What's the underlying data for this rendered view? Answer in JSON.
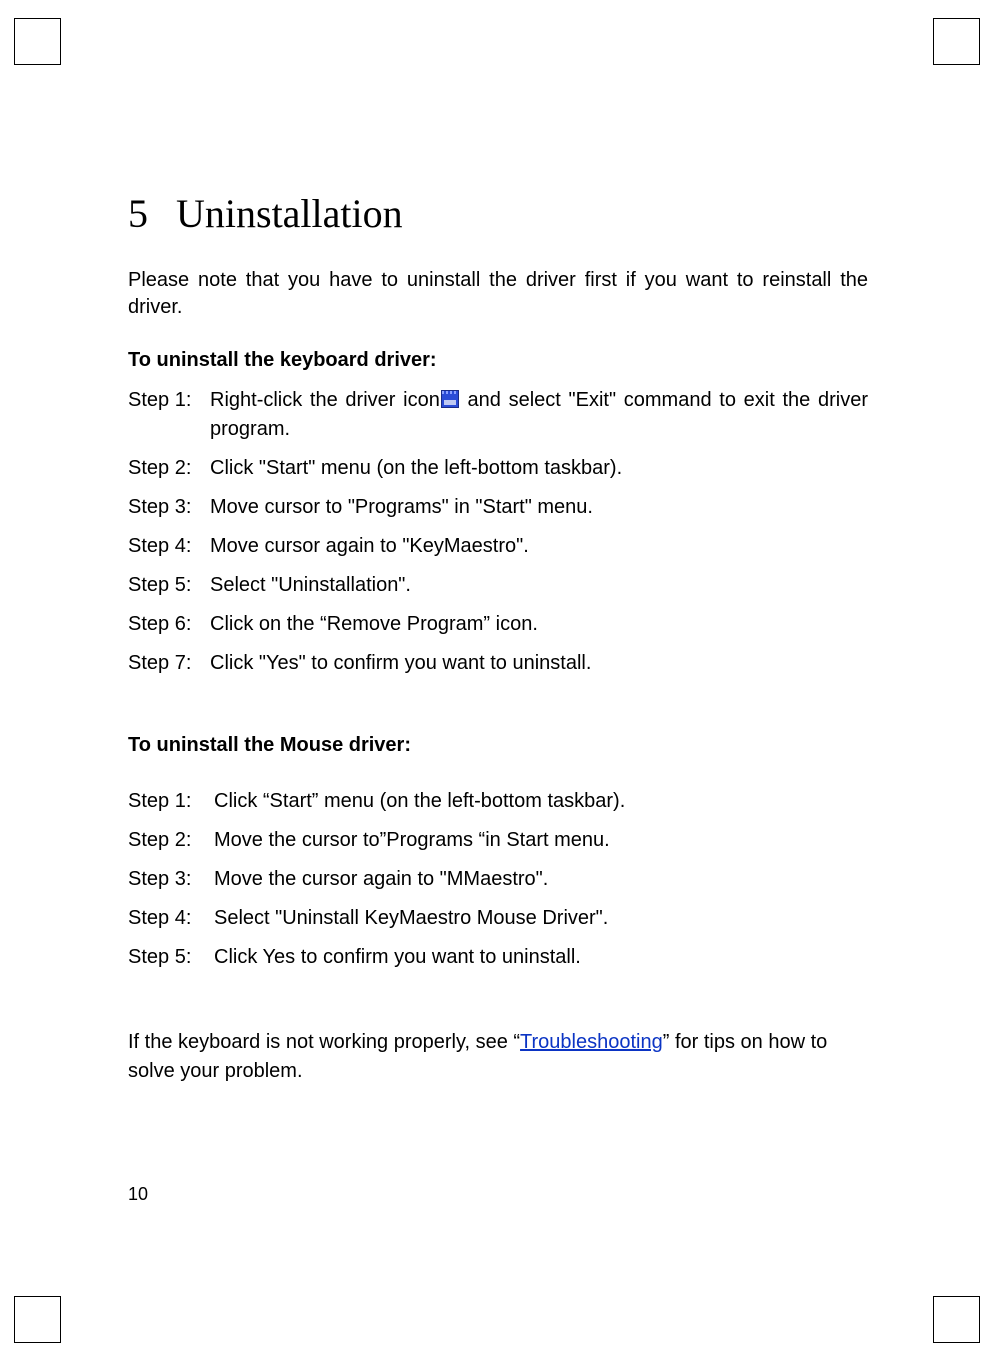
{
  "heading": {
    "number": "5",
    "title": "Uninstallation"
  },
  "intro": "Please note that you have to uninstall the driver first if you want to reinstall the driver.",
  "kb": {
    "heading": "To uninstall the keyboard driver:",
    "steps": [
      {
        "label": "Step 1:",
        "pre": "Right-click the driver icon",
        "post": " and select \"Exit\" command to exit the driver program."
      },
      {
        "label": "Step 2:",
        "text": "Click \"Start\" menu (on the left-bottom taskbar)."
      },
      {
        "label": "Step 3:",
        "text": "Move cursor to \"Programs\" in \"Start\" menu."
      },
      {
        "label": "Step 4:",
        "text": "Move cursor again to \"KeyMaestro\"."
      },
      {
        "label": "Step 5:",
        "text": "Select \"Uninstallation\"."
      },
      {
        "label": "Step 6:",
        "text": "Click on the “Remove Program” icon."
      },
      {
        "label": "Step 7:",
        "text": "Click \"Yes\" to confirm you want to uninstall."
      }
    ]
  },
  "mouse": {
    "heading": "To uninstall the Mouse driver:",
    "steps": [
      {
        "label": "Step 1:",
        "text": "Click “Start” menu (on the left-bottom taskbar)."
      },
      {
        "label": "Step 2:",
        "text": "Move the cursor to”Programs “in Start menu."
      },
      {
        "label": "Step 3:",
        "text": "Move the cursor again to \"MMaestro\"."
      },
      {
        "label": "Step 4:",
        "text": "Select \"Uninstall KeyMaestro Mouse Driver\"."
      },
      {
        "label": "Step 5:",
        "text": "Click Yes to confirm you want to uninstall."
      }
    ]
  },
  "closing": {
    "pre": "If the keyboard is not working properly, see “",
    "link": "Troubleshooting",
    "post": "” for tips on how to solve your problem."
  },
  "page_number": "10"
}
